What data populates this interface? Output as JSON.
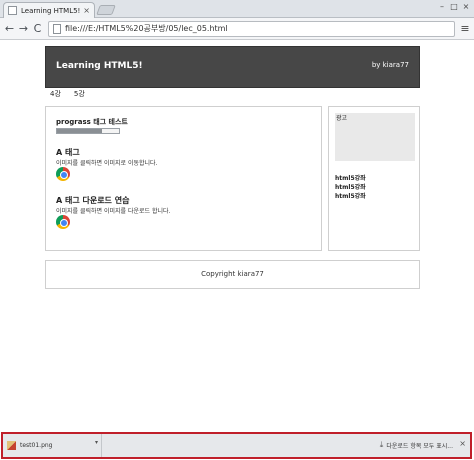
{
  "browser": {
    "tab_title": "Learning HTML5!",
    "tab_close": "×",
    "url": "file:///E:/HTML5%20공부방/05/lec_05.html",
    "back": "←",
    "forward": "→",
    "reload": "C",
    "menu": "≡",
    "window_minimize": "–",
    "window_maximize": "□",
    "window_close": "×"
  },
  "page": {
    "site_title": "Learning HTML5!",
    "byline": "by kiara77",
    "nav": [
      "4강",
      "5강"
    ],
    "progress_title": "prograss 태그 테스트",
    "progress_value": 0.72,
    "sections": [
      {
        "title": "A 태그",
        "desc": "이미지를 클릭하면 이미지로 이동합니다."
      },
      {
        "title": "A 태그 다운로드 연습",
        "desc": "이미지를 클릭하면 이미지를 다운로드 합니다."
      }
    ],
    "sidebar": {
      "ad_label": "광고",
      "links": [
        "html5강좌",
        "html5강좌",
        "html5강좌"
      ]
    },
    "footer": "Copyright kiara77"
  },
  "downloads": {
    "file_name": "test01.png",
    "chevron": "▾",
    "show_all": "다운로드 항목 모두 표시...",
    "close": "×"
  },
  "colors": {
    "header_bg": "#474747",
    "download_bar_border": "#c01f2a"
  }
}
